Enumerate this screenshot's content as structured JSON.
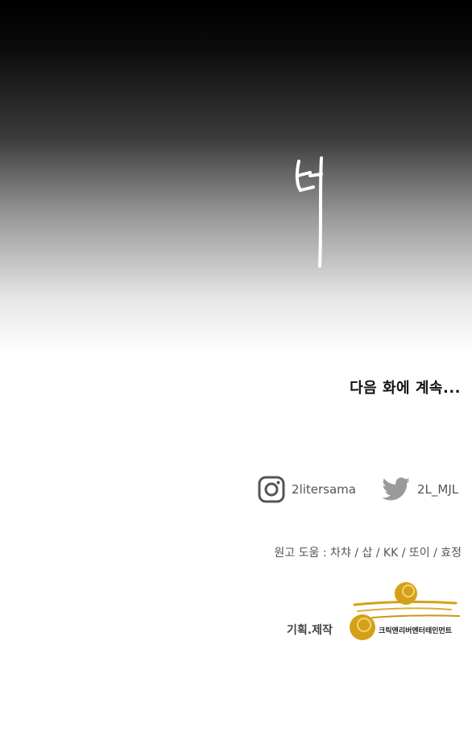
{
  "sfx_text": "탁",
  "continue_text": "다음 화에 계속...",
  "social": {
    "instagram_handle": "2litersama",
    "twitter_handle": "2L_MJL"
  },
  "credits_text": "원고 도움 : 차챠 / 삽 / KK / 또이 / 효정",
  "production": {
    "label": "기획.제작",
    "company": "크릭앤리버엔터테인먼트"
  },
  "colors": {
    "logo_gold": "#d4a017",
    "twitter_gray": "#9a9a9a",
    "text_dark": "#111111"
  }
}
